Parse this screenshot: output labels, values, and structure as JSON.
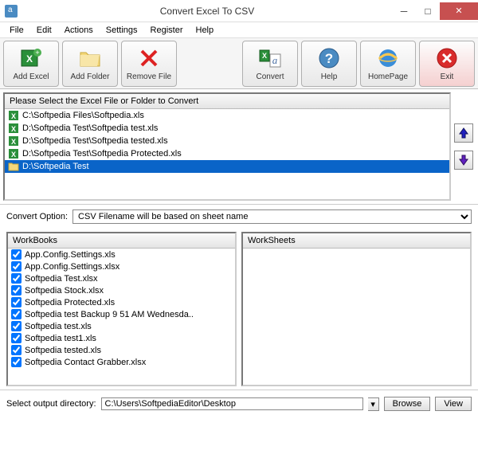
{
  "window": {
    "title": "Convert Excel To CSV"
  },
  "menu": {
    "file": "File",
    "edit": "Edit",
    "actions": "Actions",
    "settings": "Settings",
    "register": "Register",
    "help": "Help"
  },
  "toolbar": {
    "add_excel": "Add Excel",
    "add_folder": "Add Folder",
    "remove_file": "Remove File",
    "convert": "Convert",
    "help": "Help",
    "homepage": "HomePage",
    "exit": "Exit"
  },
  "filelist": {
    "header": "Please Select the Excel File or Folder to Convert",
    "items": [
      {
        "path": "C:\\Softpedia Files\\Softpedia.xls",
        "type": "file",
        "selected": false
      },
      {
        "path": "D:\\Softpedia Test\\Softpedia test.xls",
        "type": "file",
        "selected": false
      },
      {
        "path": "D:\\Softpedia Test\\Softpedia tested.xls",
        "type": "file",
        "selected": false
      },
      {
        "path": "D:\\Softpedia Test\\Softpedia Protected.xls",
        "type": "file",
        "selected": false
      },
      {
        "path": "D:\\Softpedia Test",
        "type": "folder",
        "selected": true
      }
    ]
  },
  "convert_option": {
    "label": "Convert Option:",
    "value": "CSV Filename will be based on sheet name"
  },
  "workbooks": {
    "header": "WorkBooks",
    "items": [
      {
        "name": "App.Config.Settings.xls",
        "checked": true
      },
      {
        "name": "App.Config.Settings.xlsx",
        "checked": true
      },
      {
        "name": "Softpedia Test.xlsx",
        "checked": true
      },
      {
        "name": "Softpedia Stock.xlsx",
        "checked": true
      },
      {
        "name": "Softpedia Protected.xls",
        "checked": true
      },
      {
        "name": "Softpedia test Backup 9 51 AM Wednesda..",
        "checked": true
      },
      {
        "name": "Softpedia test.xls",
        "checked": true
      },
      {
        "name": "Softpedia test1.xls",
        "checked": true
      },
      {
        "name": "Softpedia tested.xls",
        "checked": true
      },
      {
        "name": "Softpedia Contact Grabber.xlsx",
        "checked": true
      }
    ]
  },
  "worksheets": {
    "header": "WorkSheets"
  },
  "output": {
    "label": "Select  output directory:",
    "path": "C:\\Users\\SoftpediaEditor\\Desktop",
    "browse": "Browse",
    "view": "View"
  }
}
